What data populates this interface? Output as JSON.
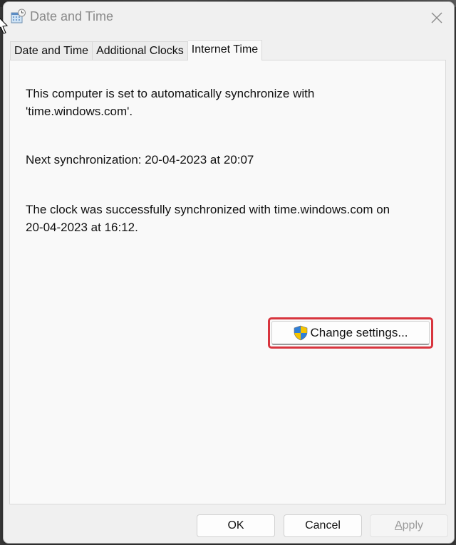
{
  "window": {
    "title": "Date and Time",
    "icon": "calendar-clock-icon",
    "close_icon": "close-icon"
  },
  "tabs": [
    {
      "label": "Date and Time",
      "active": false
    },
    {
      "label": "Additional Clocks",
      "active": false
    },
    {
      "label": "Internet Time",
      "active": true
    }
  ],
  "content": {
    "sync_line1": "This computer is set to automatically synchronize with",
    "sync_line2": "'time.windows.com'.",
    "next_sync": "Next synchronization: 20-04-2023 at 20:07",
    "last_sync_line1": "The clock was successfully synchronized with time.windows.com on",
    "last_sync_line2": "20-04-2023 at 16:12."
  },
  "change_settings": {
    "label": "Change settings...",
    "icon": "uac-shield-icon",
    "highlight_color": "#d8353e"
  },
  "footer": {
    "ok_label": "OK",
    "cancel_label": "Cancel",
    "apply_label_accel": "A",
    "apply_label_rest": "pply",
    "apply_disabled": true
  }
}
